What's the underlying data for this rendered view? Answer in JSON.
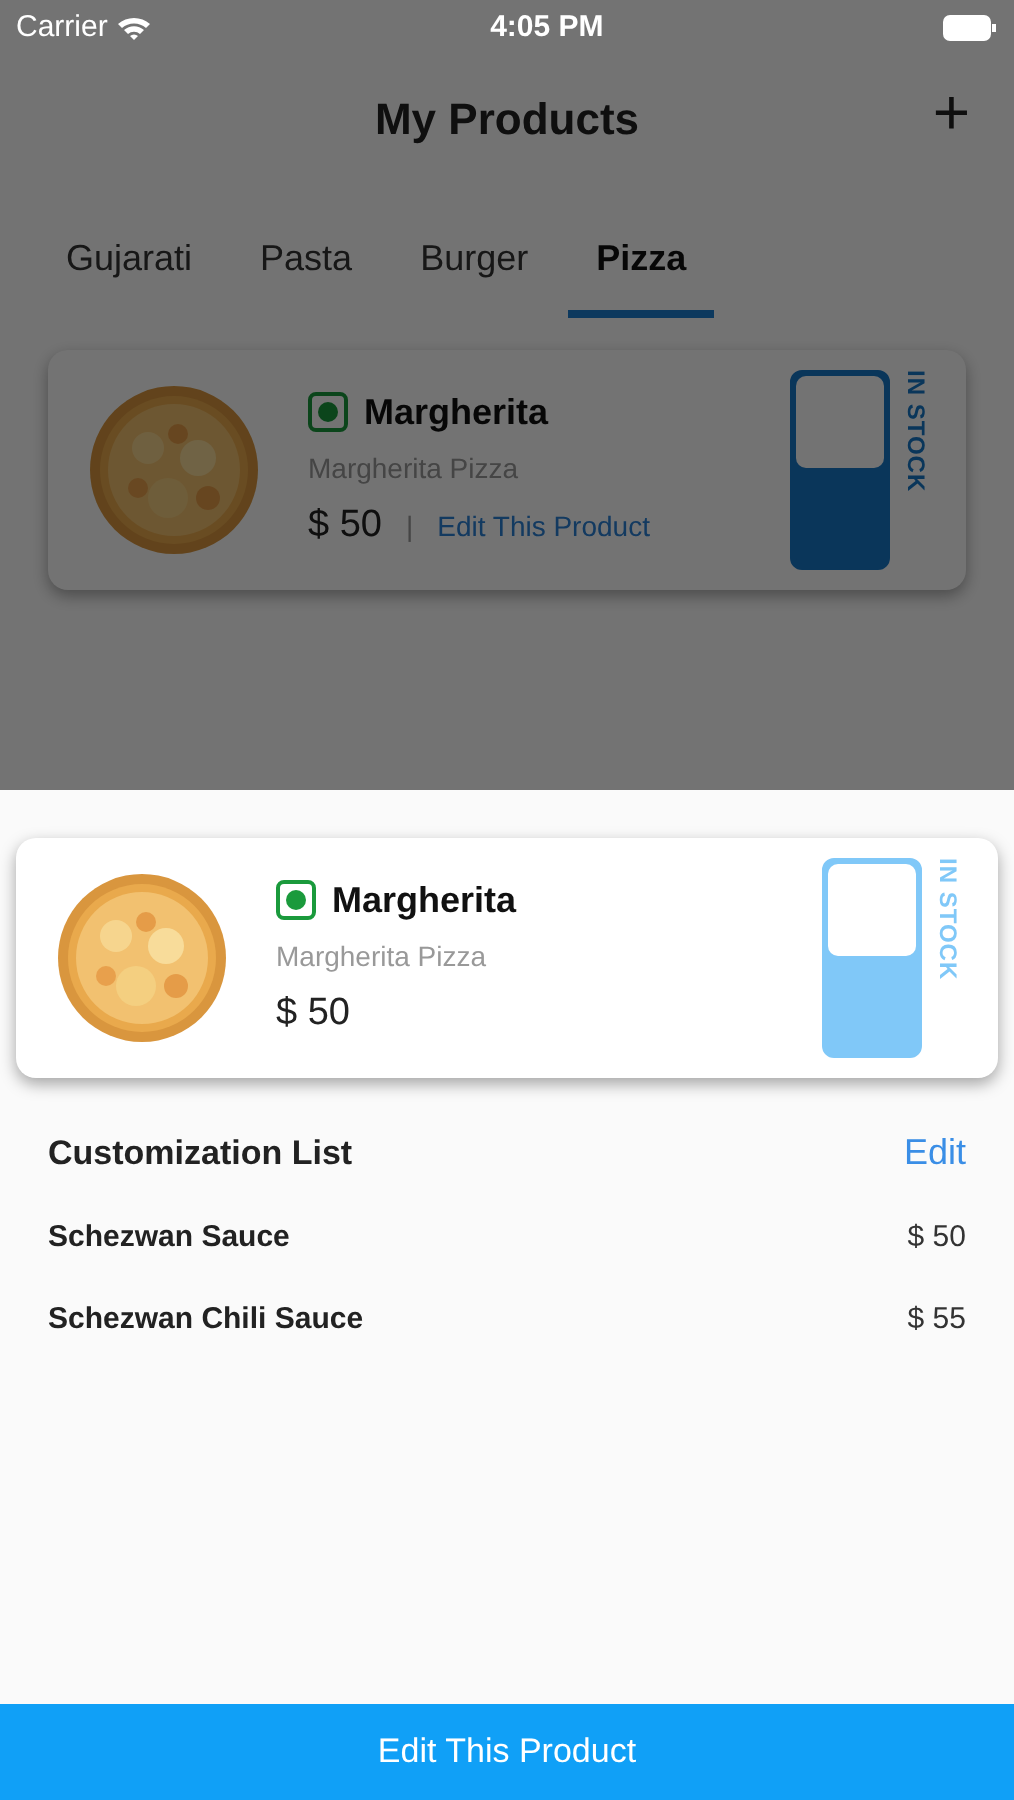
{
  "status_bar": {
    "carrier": "Carrier",
    "time": "4:05 PM"
  },
  "header": {
    "title": "My Products",
    "add_icon": "+"
  },
  "tabs": [
    {
      "label": "Gujarati",
      "selected": false
    },
    {
      "label": "Pasta",
      "selected": false
    },
    {
      "label": "Burger",
      "selected": false
    },
    {
      "label": "Pizza",
      "selected": true
    }
  ],
  "products": [
    {
      "name": "Margherita",
      "description": "Margherita Pizza",
      "price": "$ 50",
      "separator": "|",
      "edit_link": "Edit This Product",
      "stock_label": "IN STOCK",
      "in_stock": true,
      "disabled": false
    }
  ],
  "sheet": {
    "product": {
      "name": "Margherita",
      "description": "Margherita Pizza",
      "price": "$ 50",
      "stock_label": "IN STOCK",
      "in_stock": true,
      "disabled": true
    },
    "list_title": "Customization List",
    "edit": "Edit",
    "items": [
      {
        "name": "Schezwan Sauce",
        "price": "$ 50"
      },
      {
        "name": "Schezwan Chili Sauce",
        "price": "$ 55"
      }
    ],
    "button": "Edit This Product"
  }
}
